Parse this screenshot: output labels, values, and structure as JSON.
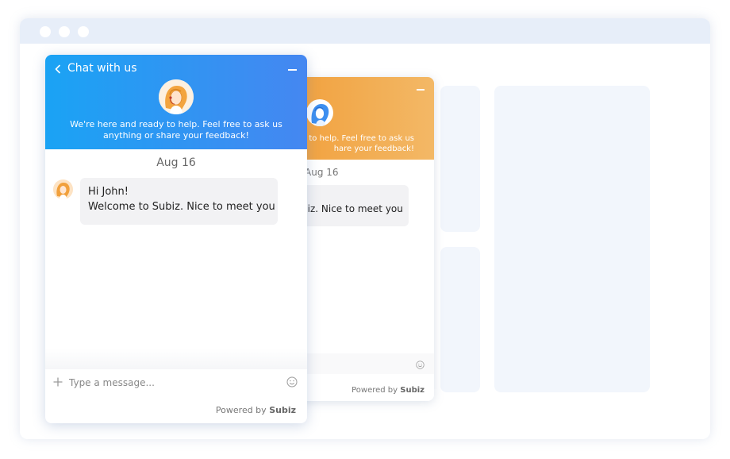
{
  "front_widget": {
    "title": "Chat with us",
    "tagline": "We're here and ready to help. Feel free to ask us\nanything or share your feedback!",
    "date": "Aug 16",
    "message_line1": "Hi John!",
    "message_line2": "Welcome to Subiz. Nice to meet you",
    "input_placeholder": "Type a message...",
    "powered_by_prefix": "Powered by",
    "powered_by_brand": "Subiz"
  },
  "back_widget": {
    "tagline": "y to help. Feel free to ask us\nhare your feedback!",
    "date": "Aug 16",
    "message": "biz. Nice to meet you",
    "powered_by_prefix": "Powered by",
    "powered_by_brand": "Subiz"
  },
  "colors": {
    "front_header_start": "#1aa3f4",
    "front_header_end": "#4587f1",
    "back_header_start": "#f1a03c",
    "back_header_end": "#f3b866",
    "window_bar": "#e7eef9",
    "placeholder_panel": "#f2f6fc"
  },
  "icons": {
    "back": "chevron-left-icon",
    "minimize": "minimize-icon",
    "attach": "plus-icon",
    "emoji": "smiley-icon"
  }
}
